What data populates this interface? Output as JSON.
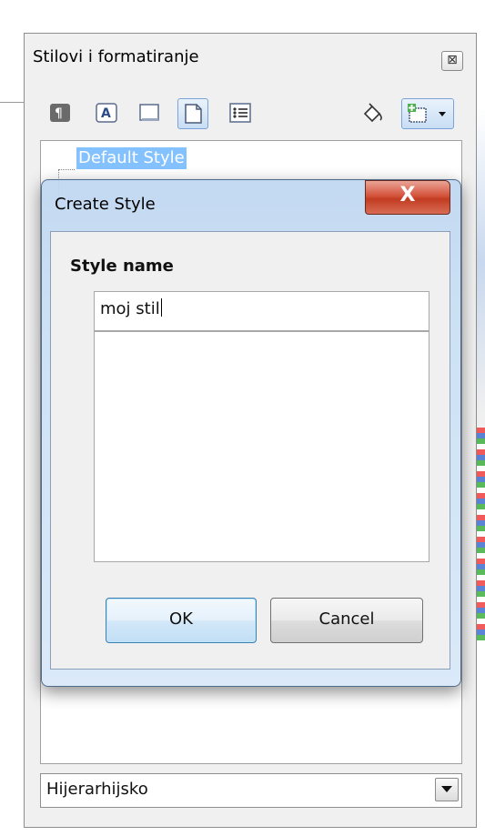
{
  "panel": {
    "title": "Stilovi i formatiranje",
    "close_glyph": "⊠",
    "toolbar_icons": [
      "paragraph-styles-icon",
      "character-styles-icon",
      "frame-styles-icon",
      "page-styles-icon",
      "list-styles-icon",
      "fill-format-icon",
      "new-style-icon"
    ],
    "active_tab": "page-styles",
    "selected_style": "Default Style",
    "filter_value": "Hijerarhijsko"
  },
  "dialog": {
    "title": "Create Style",
    "close_glyph": "X",
    "style_name_label": "Style name",
    "style_name_value": "moj stil",
    "ok_label": "OK",
    "cancel_label": "Cancel"
  },
  "colors": {
    "selection": "#3399ff",
    "close_red": "#c23c22",
    "ok_border": "#3c7fb1"
  }
}
